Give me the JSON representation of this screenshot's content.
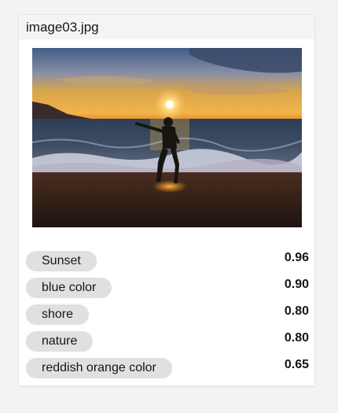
{
  "card": {
    "title": "image03.jpg"
  },
  "photo": {
    "scene": "sunset-beach-photo"
  },
  "tags": [
    {
      "label": "Sunset",
      "score": "0.96"
    },
    {
      "label": "blue color",
      "score": "0.90"
    },
    {
      "label": "shore",
      "score": "0.80"
    },
    {
      "label": "nature",
      "score": "0.80"
    },
    {
      "label": "reddish orange color",
      "score": "0.65"
    }
  ],
  "colors": {
    "pill_bg": "#e0e0e0",
    "header_bg": "#f4f4f4",
    "page_bg": "#f3f3f3"
  }
}
